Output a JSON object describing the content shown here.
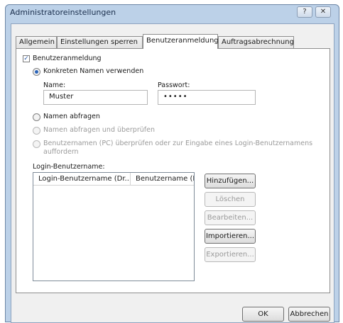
{
  "window": {
    "title": "Administratoreinstellungen",
    "help_label": "?",
    "close_label": "✕"
  },
  "tabs": [
    {
      "label": "Allgemein",
      "active": false
    },
    {
      "label": "Einstellungen sperren",
      "active": false
    },
    {
      "label": "Benutzeranmeldung",
      "active": true
    },
    {
      "label": "Auftragsabrechnung",
      "active": false
    }
  ],
  "form": {
    "enable_checkbox": {
      "label": "Benutzeranmeldung",
      "checked": true,
      "mark": "✓"
    },
    "radio_specific": {
      "label": "Konkreten Namen verwenden",
      "selected": true
    },
    "name_label": "Name:",
    "name_value": "Muster",
    "password_label": "Passwort:",
    "password_value": "•••••",
    "radio_ask": {
      "label": "Namen abfragen",
      "selected": false
    },
    "radio_ask_verify": {
      "label": "Namen abfragen und überprüfen",
      "enabled": false
    },
    "radio_verify_pc": {
      "label_line1": "Benutzernamen (PC) überprüfen oder zur Eingabe eines Login-Benutzernamens",
      "label_line2": "auffordern",
      "enabled": false
    },
    "login_list_label": "Login-Benutzername:",
    "columns": [
      "Login-Benutzername (Dr...",
      "Benutzername (PC"
    ]
  },
  "side_buttons": {
    "add": {
      "label": "Hinzufügen...",
      "enabled": true
    },
    "delete": {
      "label": "Löschen",
      "enabled": false
    },
    "edit": {
      "label": "Bearbeiten...",
      "enabled": false
    },
    "import": {
      "label": "Importieren...",
      "enabled": true
    },
    "export": {
      "label": "Exportieren...",
      "enabled": false
    }
  },
  "footer": {
    "ok_label": "OK",
    "cancel_label": "Abbrechen"
  }
}
